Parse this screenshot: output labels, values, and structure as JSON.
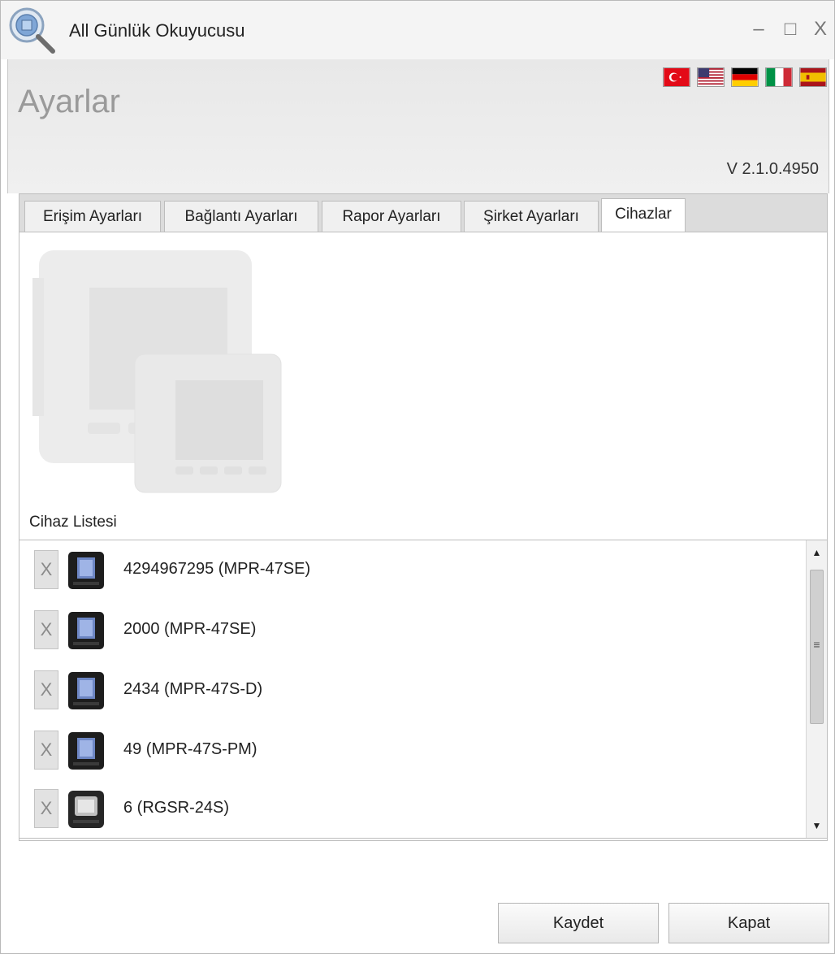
{
  "window": {
    "title": "All Günlük Okuyucusu",
    "minimize_glyph": "–",
    "maximize_glyph": "□",
    "close_glyph": "X"
  },
  "header": {
    "title": "Ayarlar",
    "version": "V 2.1.0.4950",
    "languages": [
      {
        "code": "tr",
        "icon": "turkey-flag-icon"
      },
      {
        "code": "en",
        "icon": "usa-flag-icon"
      },
      {
        "code": "de",
        "icon": "germany-flag-icon"
      },
      {
        "code": "it",
        "icon": "italy-flag-icon"
      },
      {
        "code": "es",
        "icon": "spain-flag-icon"
      }
    ]
  },
  "tabs": [
    {
      "label": "Erişim Ayarları",
      "active": false
    },
    {
      "label": "Bağlantı Ayarları",
      "active": false
    },
    {
      "label": "Rapor Ayarları",
      "active": false
    },
    {
      "label": "Şirket Ayarları",
      "active": false
    },
    {
      "label": "Cihazlar",
      "active": true
    }
  ],
  "devices_tab": {
    "list_label": "Cihaz Listesi",
    "remove_glyph": "X",
    "devices": [
      {
        "name": "4294967295 (MPR-47SE)",
        "icon": "mpr-meter-icon"
      },
      {
        "name": "2000 (MPR-47SE)",
        "icon": "mpr-meter-icon"
      },
      {
        "name": "2434 (MPR-47S-D)",
        "icon": "mpr-meter-icon"
      },
      {
        "name": "49 (MPR-47S-PM)",
        "icon": "mpr-meter-icon"
      },
      {
        "name": "6 (RGSR-24S)",
        "icon": "rgsr-relay-icon"
      }
    ]
  },
  "footer": {
    "save_label": "Kaydet",
    "close_label": "Kapat"
  },
  "colors": {
    "header_title": "#9a9a9a",
    "tab_strip": "#dcdcdc",
    "panel_border": "#bdbdbd"
  }
}
